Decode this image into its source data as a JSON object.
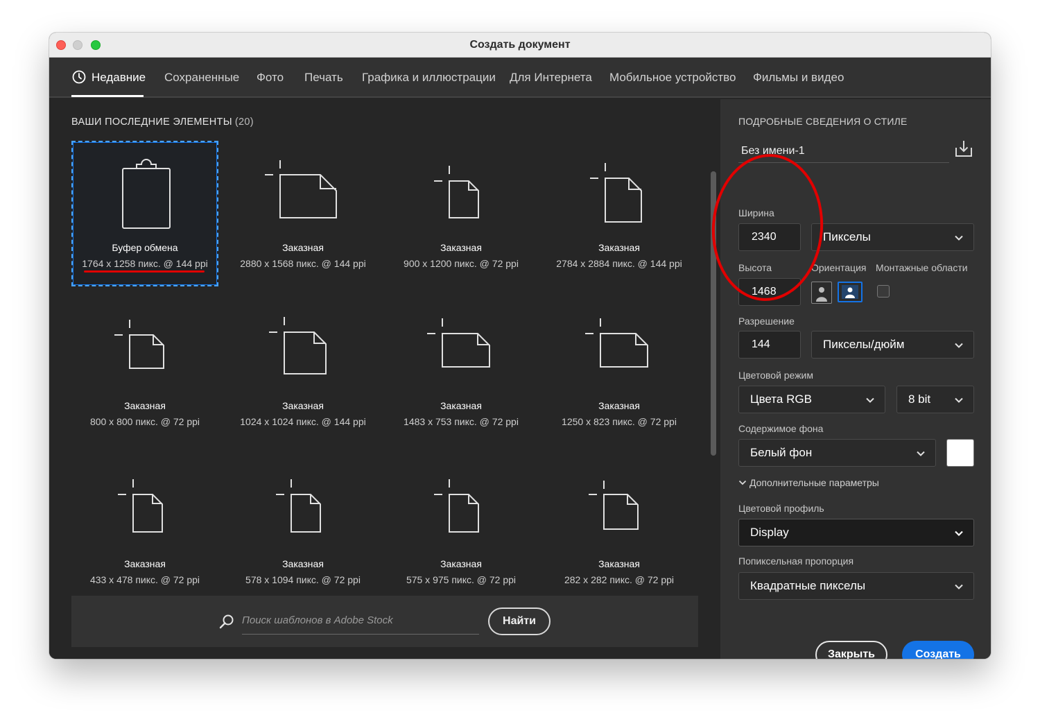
{
  "window": {
    "title": "Создать документ"
  },
  "tabs": [
    {
      "label": "Недавние",
      "active": true,
      "icon": "clock-icon"
    },
    {
      "label": "Сохраненные"
    },
    {
      "label": "Фото"
    },
    {
      "label": "Печать"
    },
    {
      "label": "Графика и иллюстрации"
    },
    {
      "label": "Для Интернета"
    },
    {
      "label": "Мобильное устройство"
    },
    {
      "label": "Фильмы и видео"
    }
  ],
  "recent": {
    "title": "ВАШИ ПОСЛЕДНИЕ ЭЛЕМЕНТЫ",
    "count": "(20)",
    "items": [
      {
        "name": "Буфер обмена",
        "size": "1764 x 1258 пикс. @ 144 ppi",
        "icon": "clipboard-icon",
        "selected": true
      },
      {
        "name": "Заказная",
        "size": "2880 x 1568 пикс. @ 144 ppi",
        "icon": "document-icon"
      },
      {
        "name": "Заказная",
        "size": "900 x 1200 пикс. @ 72 ppi",
        "icon": "document-icon"
      },
      {
        "name": "Заказная",
        "size": "2784 x 2884 пикс. @ 144 ppi",
        "icon": "document-icon"
      },
      {
        "name": "Заказная",
        "size": "800 x 800 пикс. @ 72 ppi",
        "icon": "document-icon"
      },
      {
        "name": "Заказная",
        "size": "1024 x 1024 пикс. @ 144 ppi",
        "icon": "document-icon"
      },
      {
        "name": "Заказная",
        "size": "1483 x 753 пикс. @ 72 ppi",
        "icon": "document-icon"
      },
      {
        "name": "Заказная",
        "size": "1250 x 823 пикс. @ 72 ppi",
        "icon": "document-icon"
      },
      {
        "name": "Заказная",
        "size": "433 x 478 пикс. @ 72 ppi",
        "icon": "document-icon"
      },
      {
        "name": "Заказная",
        "size": "578 x 1094 пикс. @ 72 ppi",
        "icon": "document-icon"
      },
      {
        "name": "Заказная",
        "size": "575 x 975 пикс. @ 72 ppi",
        "icon": "document-icon"
      },
      {
        "name": "Заказная",
        "size": "282 x 282 пикс. @ 72 ppi",
        "icon": "document-icon"
      }
    ]
  },
  "search": {
    "placeholder": "Поиск шаблонов в Adobe Stock",
    "button": "Найти"
  },
  "details": {
    "heading": "ПОДРОБНЫЕ СВЕДЕНИЯ О СТИЛЕ",
    "doc_name": "Без имени-1",
    "width_label": "Ширина",
    "width_value": "2340",
    "width_unit": "Пикселы",
    "height_label": "Высота",
    "height_value": "1468",
    "orientation_label": "Ориентация",
    "artboards_label": "Монтажные области",
    "resolution_label": "Разрешение",
    "resolution_value": "144",
    "resolution_unit": "Пикселы/дюйм",
    "color_mode_label": "Цветовой режим",
    "color_mode": "Цвета RGB",
    "bit_depth": "8 bit",
    "background_label": "Содержимое фона",
    "background": "Белый фон",
    "background_color": "#ffffff",
    "advanced_label": "Дополнительные параметры",
    "color_profile_label": "Цветовой профиль",
    "color_profile": "Display",
    "pixel_aspect_label": "Попиксельная пропорция",
    "pixel_aspect": "Квадратные пикселы"
  },
  "actions": {
    "close": "Закрыть",
    "create": "Создать"
  },
  "colors": {
    "accent": "#1473e6",
    "annotation": "#e10000"
  }
}
